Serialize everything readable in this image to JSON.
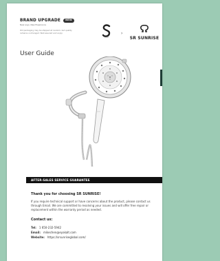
{
  "header": {
    "brand_title": "BRAND UPGRADE",
    "badge": "NEW",
    "subtitle": "New Logo, New Experience",
    "note": "Old packaging may be shipped at random, but quality remains unchanged. Well assured and enjoy",
    "logo_text": "SR SUNRISE"
  },
  "title": "User Guide",
  "banner": "AFTER-SALES SERVICE GUARANTEE",
  "info": {
    "thanks": "Thank you for choosing SR SUNRISE!",
    "body": "If you require technical support or have concerns about the product, please contact us through Email. We are committed to resolving your issues and will offer free repair or replacement within the warranty period as needed.",
    "contact_title": "Contact us:",
    "tel_label": "Tel:",
    "tel": "1 650-232-5942",
    "email_label": "Email:",
    "email": "mikechen@eyakalt.com",
    "website_label": "Website:",
    "website": "https://srsunriseglobal.com/"
  },
  "colors": {
    "background": "#9ccbb4",
    "banner": "#111111",
    "edge_tab": "#1e3d36"
  },
  "icons": [
    "s-logo-icon",
    "arrow-right-icon",
    "omega-logo-icon",
    "handheld-shower-illustration"
  ]
}
